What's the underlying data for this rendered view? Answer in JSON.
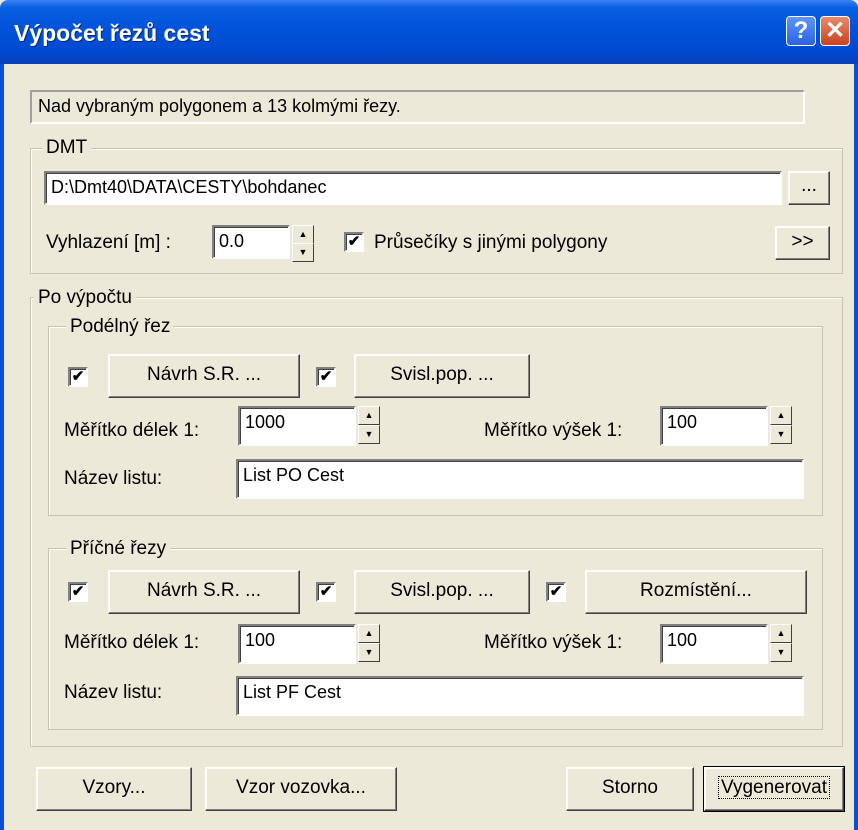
{
  "window": {
    "title": "Výpočet řezů cest",
    "help_label": "?",
    "close_label": "✕"
  },
  "status_text": "Nad vybraným polygonem a 13 kolmými řezy.",
  "dmt": {
    "group_label": "DMT",
    "path": "D:\\Dmt40\\DATA\\CESTY\\bohdanec",
    "browse_label": "...",
    "smoothing_label": "Vyhlazení [m] :",
    "smoothing_value": "0.0",
    "intersections_label": "Průsečíky s jinými polygony",
    "intersections_checked": true,
    "more_label": ">>"
  },
  "after": {
    "group_label": "Po výpočtu",
    "longitudinal": {
      "group_label": "Podélný řez",
      "design_checked": true,
      "design_label": "Návrh S.R. ...",
      "vertical_checked": true,
      "vertical_label": "Svisl.pop. ...",
      "length_scale_label": "Měřítko délek 1:",
      "length_scale_value": "1000",
      "height_scale_label": "Měřítko výšek 1:",
      "height_scale_value": "100",
      "sheet_name_label": "Název listu:",
      "sheet_name_value": "List PO Cest"
    },
    "cross": {
      "group_label": "Příčné řezy",
      "design_checked": true,
      "design_label": "Návrh S.R. ...",
      "vertical_checked": true,
      "vertical_label": "Svisl.pop. ...",
      "layout_checked": true,
      "layout_label": "Rozmístění...",
      "length_scale_label": "Měřítko délek 1:",
      "length_scale_value": "100",
      "height_scale_label": "Měřítko výšek 1:",
      "height_scale_value": "100",
      "sheet_name_label": "Název listu:",
      "sheet_name_value": "List PF Cest"
    }
  },
  "footer": {
    "templates_label": "Vzory...",
    "road_template_label": "Vzor vozovka...",
    "cancel_label": "Storno",
    "generate_label": "Vygenerovat"
  },
  "glyphs": {
    "check": "✔",
    "up": "▲",
    "down": "▼"
  }
}
